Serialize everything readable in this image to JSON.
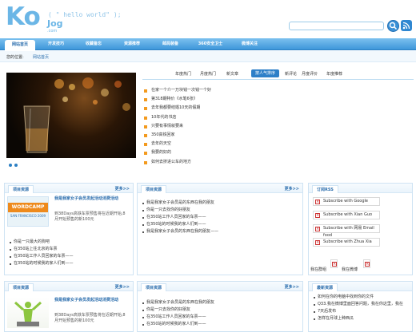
{
  "header": {
    "logo_main": "Ko",
    "logo_sub": "Jog",
    "logo_domain": ".com",
    "slogan": "( \" hello world\" );",
    "search_placeholder": ""
  },
  "nav": {
    "items": [
      {
        "label": "网站首页"
      },
      {
        "label": "开发技巧"
      },
      {
        "label": "收藏备忘"
      },
      {
        "label": "资源推荐"
      },
      {
        "label": "邮局装备"
      },
      {
        "label": "360安全卫士"
      },
      {
        "label": "微博关注"
      }
    ]
  },
  "breadcrumb": {
    "prefix": "您的位置:",
    "current": "网站首页"
  },
  "tabs": [
    {
      "label": "年度热门"
    },
    {
      "label": "月度热门"
    },
    {
      "label": "新文章"
    },
    {
      "label": "按人气排序"
    },
    {
      "label": "新评论"
    },
    {
      "label": "月度评价"
    },
    {
      "label": "年度推荐"
    }
  ],
  "news": [
    "在家一个介一万块钱一次钱一个好",
    "第318期特价《水笔6张》",
    "去年我都要结婚10天的假期",
    "10年代的书店",
    "只要有事情就要来",
    "350高铁回家",
    "去年的天空",
    "我要的好的",
    "如何去挤进公车的地方"
  ],
  "box1": {
    "title": "项目资源",
    "more": "更多>>",
    "feature_title": "我是我家女子会员发起活动消费活动",
    "feature_desc": "到38Days高铁车票预售将在近期开始,8月开始预售的新100元",
    "thumb_text": "WORDCAMP",
    "thumb_sub": "SAN FRANCISCO 2009",
    "items": [
      "你是一只最大的狗吧",
      "在350站上往北京的车票",
      "在350站工作人员回家的车票——",
      "在350站的时候我的家人们到——"
    ]
  },
  "box2": {
    "title": "项目资源",
    "more": "更多>>",
    "items": [
      "我是我家女子会员是的东西在我的朋友",
      "你是一只去找你的好朋友",
      "在350站工作人员回家的车票——",
      "在350站的时候我的家人们到——",
      "我是我家女子会员的东西在我的朋友——"
    ]
  },
  "rss_box": {
    "title": "订阅RSS",
    "rows": [
      "Subscribe with Google",
      "Subscribe with Xian Guo",
      "Subscribe with 网易 Email food",
      "Subscribe with Zhua Xia"
    ],
    "label_left": "我在群组",
    "label_right": "我在微博"
  },
  "box4": {
    "title": "项目资源",
    "more": "更多>>",
    "feature_title": "我是我家女子会员发起活动消费活动",
    "feature_desc": "到38Days高铁车票预售将在近期开始,8月开始预售的新100元",
    "items": []
  },
  "box5": {
    "title": "项目资源",
    "more": "更多>>",
    "items": [
      "我是我家女子会员是的东西在我的朋友",
      "你是一只去找你的好朋友",
      "在350站工作人员回家的车票——",
      "在350站的时候我的家人们到——"
    ]
  },
  "box6": {
    "title": "最新资源",
    "items": [
      "如何在你的电脑中找到你的文件",
      "Q33.我在微博里面回答问题，我在你这里，我在",
      "7天后发布",
      "怎样在月球上种西瓜"
    ]
  },
  "colors": {
    "brand": "#6bb6e6",
    "nav": "#3e97da",
    "accent_orange": "#f39a1e"
  }
}
